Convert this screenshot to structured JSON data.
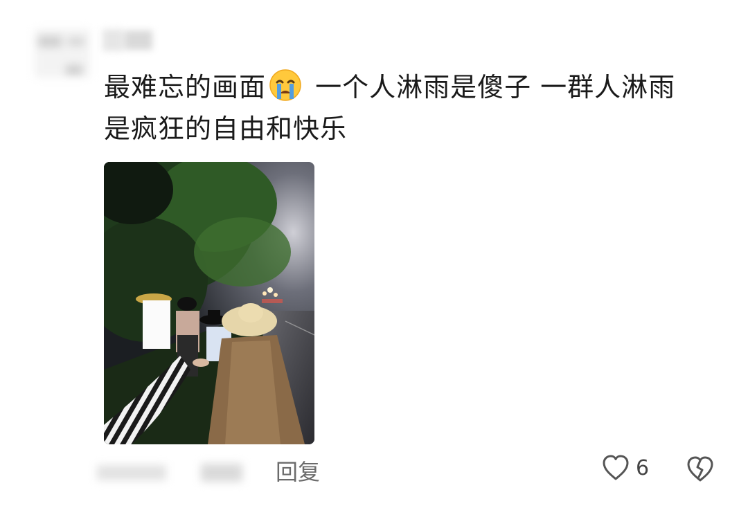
{
  "comment": {
    "line1": "最难忘的画面",
    "emoji": "loudly-crying-face-emoji",
    "line1_rest": " 一个人淋雨是傻子 一群人淋雨",
    "line2": "是疯狂的自由和快乐"
  },
  "photo": {
    "subject": "group-in-rain-at-night"
  },
  "actions": {
    "reply_label": "回复",
    "like_count": "6",
    "like_icon": "heart-outline-icon",
    "dislike_icon": "broken-heart-icon"
  },
  "colors": {
    "text": "#1a1a1a",
    "muted": "#6b6b6b",
    "icon": "#555555",
    "emoji_yellow": "#FFC93C",
    "emoji_tear": "#4A9BE8"
  }
}
